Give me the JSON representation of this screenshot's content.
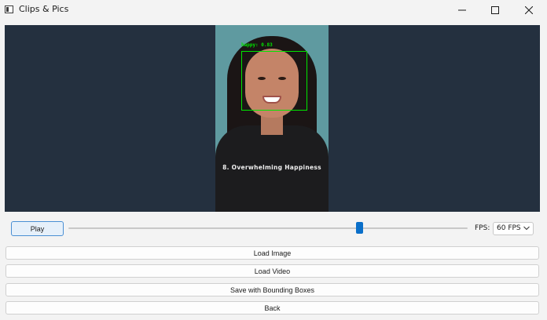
{
  "window": {
    "title": "Clips & Pics",
    "icon": "app-window-icon",
    "controls": [
      "minimize-icon",
      "maximize-icon",
      "close-icon"
    ]
  },
  "video": {
    "detection_label": "happy: 0.83",
    "caption": "8. Overwhelming Happiness",
    "bbox_color": "#00e600"
  },
  "controls": {
    "play_label": "Play",
    "seek_position": 0.73,
    "fps_label": "FPS:",
    "fps_value": "60 FPS"
  },
  "actions": {
    "load_image": "Load Image",
    "load_video": "Load Video",
    "save_bbox": "Save with Bounding Boxes",
    "back": "Back"
  },
  "colors": {
    "accent": "#0a6fc9",
    "video_bg": "#24303f",
    "window_bg": "#f3f3f3"
  }
}
